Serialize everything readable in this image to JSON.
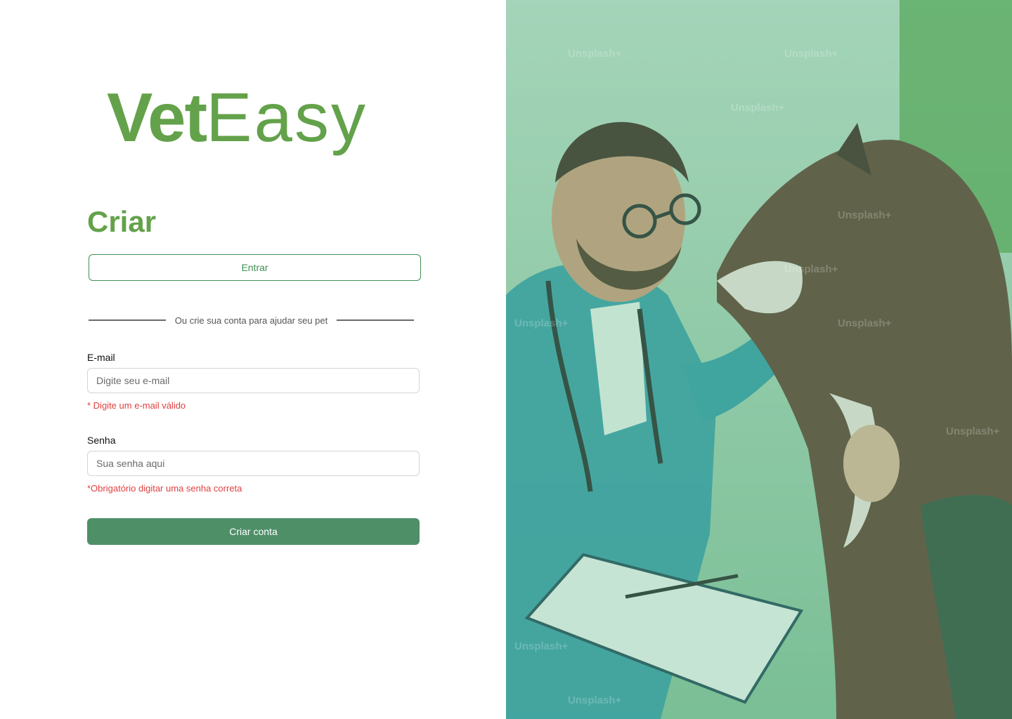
{
  "brand": {
    "logo_bold": "Vet",
    "logo_light": "Easy",
    "color": "#63a24a"
  },
  "form": {
    "title": "Criar",
    "login_button": "Entrar",
    "divider_text": "Ou crie sua conta para ajudar seu pet",
    "email": {
      "label": "E-mail",
      "placeholder": "Digite seu e-mail",
      "error": "* Digite um e-mail válido"
    },
    "password": {
      "label": "Senha",
      "placeholder": "Sua senha aqui",
      "error": "*Obrigatório digitar uma senha correta"
    },
    "submit_button": "Criar conta"
  },
  "photo": {
    "watermark": "Unsplash+",
    "overlay_color": "#6fbf8f"
  },
  "colors": {
    "primary": "#4f8f68",
    "accent": "#63a24a",
    "error": "#e04040",
    "outline": "#3f8f55"
  }
}
